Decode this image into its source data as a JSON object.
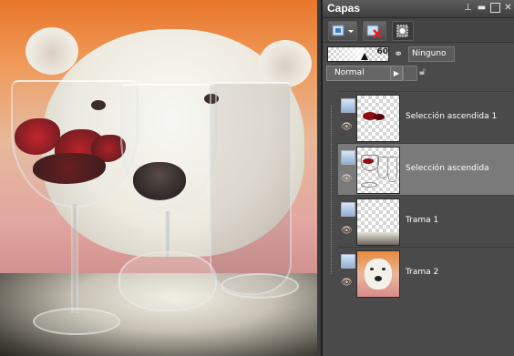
{
  "panel": {
    "title": "Capas",
    "titlebar_buttons": [
      "pin-icon",
      "minimize-icon",
      "maximize-icon",
      "close-icon"
    ]
  },
  "toolbar": {
    "tools": [
      "new-layer-icon",
      "dropdown-arrow-icon",
      "delete-layer-icon",
      "mask-icon"
    ]
  },
  "opacity": {
    "value": "60",
    "fraction": 0.6,
    "link_mode": "Ninguno"
  },
  "blend": {
    "mode": "Normal",
    "arrow": "▶"
  },
  "layers": [
    {
      "name": "Selección ascendida 1",
      "selected": false,
      "thumb": "roses"
    },
    {
      "name": "Selección ascendida",
      "selected": true,
      "thumb": "glasses"
    },
    {
      "name": "Trama 1",
      "selected": false,
      "thumb": "table"
    },
    {
      "name": "Trama 2",
      "selected": false,
      "thumb": "bear"
    }
  ],
  "colors": {
    "panel_bg": "#4a4a4a",
    "selected_row": "#7a7a7a",
    "title_text": "#ffffff"
  }
}
